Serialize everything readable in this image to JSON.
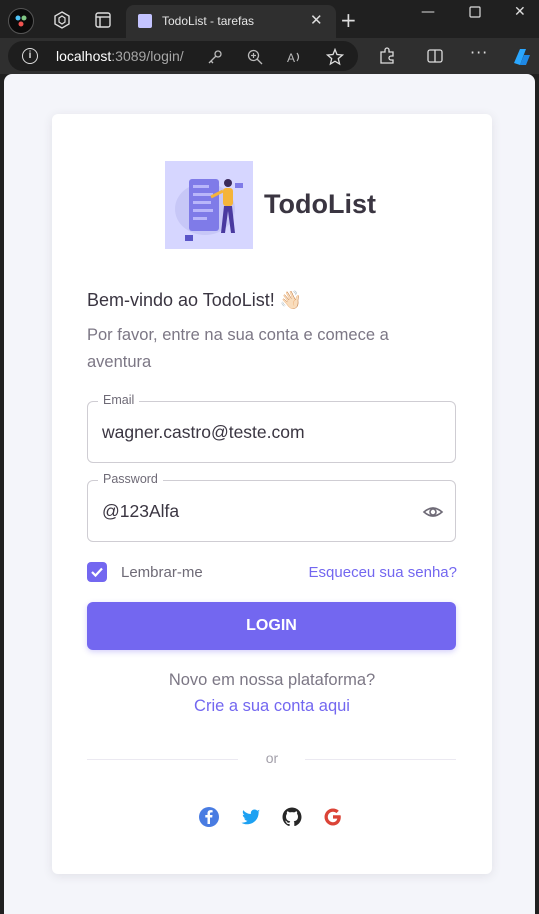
{
  "browser": {
    "tab_title": "TodoList - tarefas",
    "url_host": "localhost",
    "url_rest": ":3089/login/"
  },
  "login": {
    "brand": "TodoList",
    "welcome": "Bem-vindo ao TodoList! 👋🏻",
    "subtitle": "Por favor, entre na sua conta e comece a aventura",
    "email_label": "Email",
    "email_value": "wagner.castro@teste.com",
    "password_label": "Password",
    "password_value": "@123Alfa",
    "remember_label": "Lembrar-me",
    "remember_checked": true,
    "forgot_link": "Esqueceu sua senha?",
    "login_button": "LOGIN",
    "new_question": "Novo em nossa plataforma?",
    "create_link": "Crie a sua conta aqui",
    "divider_text": "or",
    "social": [
      "facebook-icon",
      "twitter-icon",
      "github-icon",
      "google-icon"
    ]
  },
  "colors": {
    "primary": "#7367f0",
    "text": "#3a3541",
    "muted": "#7c7785"
  }
}
